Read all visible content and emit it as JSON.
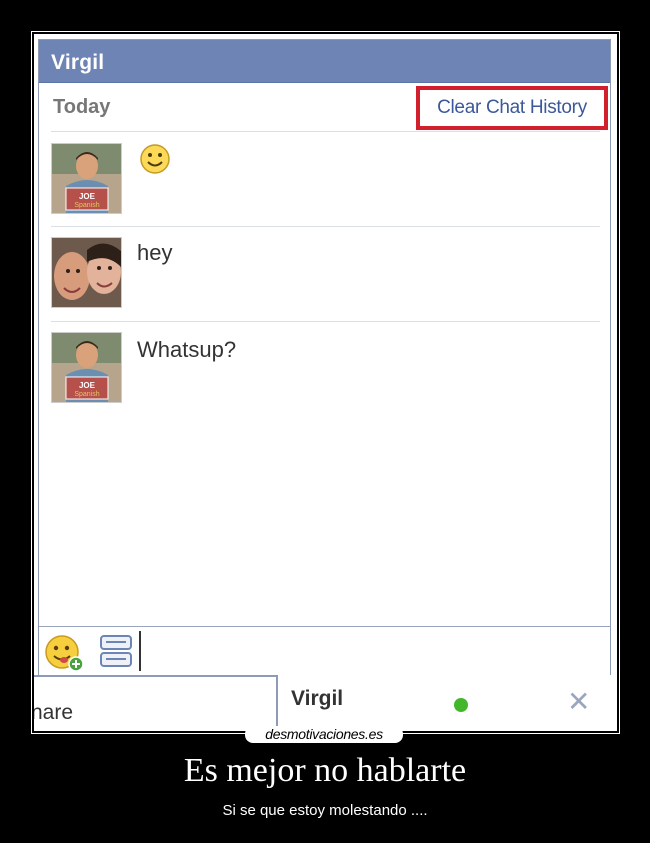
{
  "chat": {
    "title": "Virgil",
    "day_label": "Today",
    "clear_history_label": "Clear Chat History",
    "messages": [
      {
        "type": "emoticon",
        "icon": "smiley-icon",
        "avatar": "avatar-joe"
      },
      {
        "text": "hey",
        "avatar": "avatar-virgil"
      },
      {
        "text": "Whatsup?",
        "avatar": "avatar-joe"
      }
    ],
    "input": {
      "value": "",
      "placeholder": ""
    }
  },
  "dock": {
    "left_tab_label": "nare",
    "active_tab_name": "Virgil",
    "close_symbol": "✕",
    "online_color": "#42b72a"
  },
  "poster": {
    "watermark": "desmotivaciones.es",
    "title": "Es mejor no hablarte",
    "subtitle": "Si se que estoy molestando ...."
  },
  "colors": {
    "titlebar": "#6d84b4",
    "highlight_box": "#d21f2e",
    "link": "#3b5998"
  }
}
